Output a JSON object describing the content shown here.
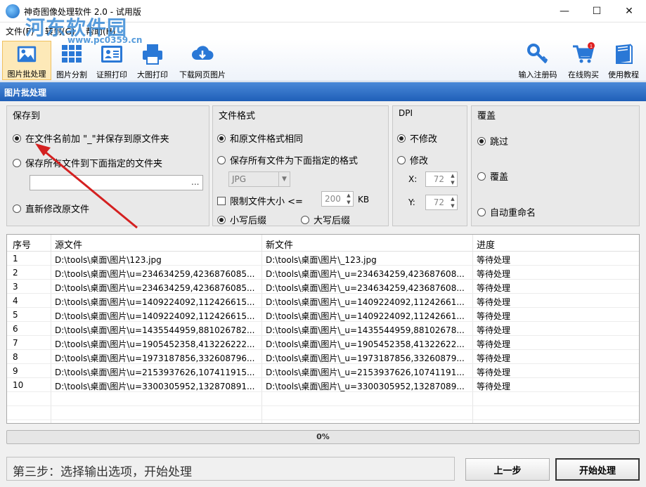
{
  "window": {
    "title": "神奇图像处理软件 2.0 - 试用版",
    "min": "—",
    "max": "☐",
    "close": "✕"
  },
  "watermark": {
    "name": "河东软件园",
    "url": "www.pc0359.cn"
  },
  "menu": [
    "文件(F)",
    "转到(G)",
    "帮助(H)"
  ],
  "toolbar": {
    "left": [
      "图片批处理",
      "图片分割",
      "证照打印",
      "大图打印",
      "下载网页图片"
    ],
    "right": [
      "输入注册码",
      "在线购买",
      "使用教程"
    ],
    "cart_badge": "1"
  },
  "section_title": "图片批处理",
  "save_to": {
    "title": "保存到",
    "opt1": "在文件名前加 \"_\"并保存到原文件夹",
    "opt2": "保存所有文件到下面指定的文件夹",
    "folder_value": "",
    "browse": "...",
    "opt3": "直新修改原文件"
  },
  "file_format": {
    "title": "文件格式",
    "opt1": "和原文件格式相同",
    "opt2": "保存所有文件为下面指定的格式",
    "format_value": "JPG",
    "limit_label": "限制文件大小 <=",
    "limit_value": "200",
    "limit_unit": "KB",
    "lower": "小写后缀",
    "upper": "大写后缀"
  },
  "dpi": {
    "title": "DPI",
    "opt1": "不修改",
    "opt2": "修改",
    "x_label": "X:",
    "x_value": "72",
    "y_label": "Y:",
    "y_value": "72"
  },
  "overwrite": {
    "title": "覆盖",
    "opt1": "跳过",
    "opt2": "覆盖",
    "opt3": "自动重命名"
  },
  "table": {
    "headers": [
      "序号",
      "源文件",
      "新文件",
      "进度"
    ],
    "rows": [
      [
        "1",
        "D:\\tools\\桌面\\图片\\123.jpg",
        "D:\\tools\\桌面\\图片\\_123.jpg",
        "等待处理"
      ],
      [
        "2",
        "D:\\tools\\桌面\\图片\\u=234634259,4236876085...",
        "D:\\tools\\桌面\\图片\\_u=234634259,423687608...",
        "等待处理"
      ],
      [
        "3",
        "D:\\tools\\桌面\\图片\\u=234634259,4236876085...",
        "D:\\tools\\桌面\\图片\\_u=234634259,423687608...",
        "等待处理"
      ],
      [
        "4",
        "D:\\tools\\桌面\\图片\\u=1409224092,112426615...",
        "D:\\tools\\桌面\\图片\\_u=1409224092,11242661...",
        "等待处理"
      ],
      [
        "5",
        "D:\\tools\\桌面\\图片\\u=1409224092,112426615...",
        "D:\\tools\\桌面\\图片\\_u=1409224092,11242661...",
        "等待处理"
      ],
      [
        "6",
        "D:\\tools\\桌面\\图片\\u=1435544959,881026782...",
        "D:\\tools\\桌面\\图片\\_u=1435544959,88102678...",
        "等待处理"
      ],
      [
        "7",
        "D:\\tools\\桌面\\图片\\u=1905452358,413226222...",
        "D:\\tools\\桌面\\图片\\_u=1905452358,41322622...",
        "等待处理"
      ],
      [
        "8",
        "D:\\tools\\桌面\\图片\\u=1973187856,332608796...",
        "D:\\tools\\桌面\\图片\\_u=1973187856,33260879...",
        "等待处理"
      ],
      [
        "9",
        "D:\\tools\\桌面\\图片\\u=2153937626,107411915...",
        "D:\\tools\\桌面\\图片\\_u=2153937626,10741191...",
        "等待处理"
      ],
      [
        "10",
        "D:\\tools\\桌面\\图片\\u=3300305952,132870891...",
        "D:\\tools\\桌面\\图片\\_u=3300305952,13287089...",
        "等待处理"
      ]
    ]
  },
  "progress": {
    "text": "0%",
    "value": 0
  },
  "status_text": "第三步：选择输出选项，开始处理",
  "buttons": {
    "prev": "上一步",
    "start": "开始处理"
  },
  "colors": {
    "accent": "#1f5fb8",
    "progress": "#06b025",
    "arrow": "#d42020"
  }
}
